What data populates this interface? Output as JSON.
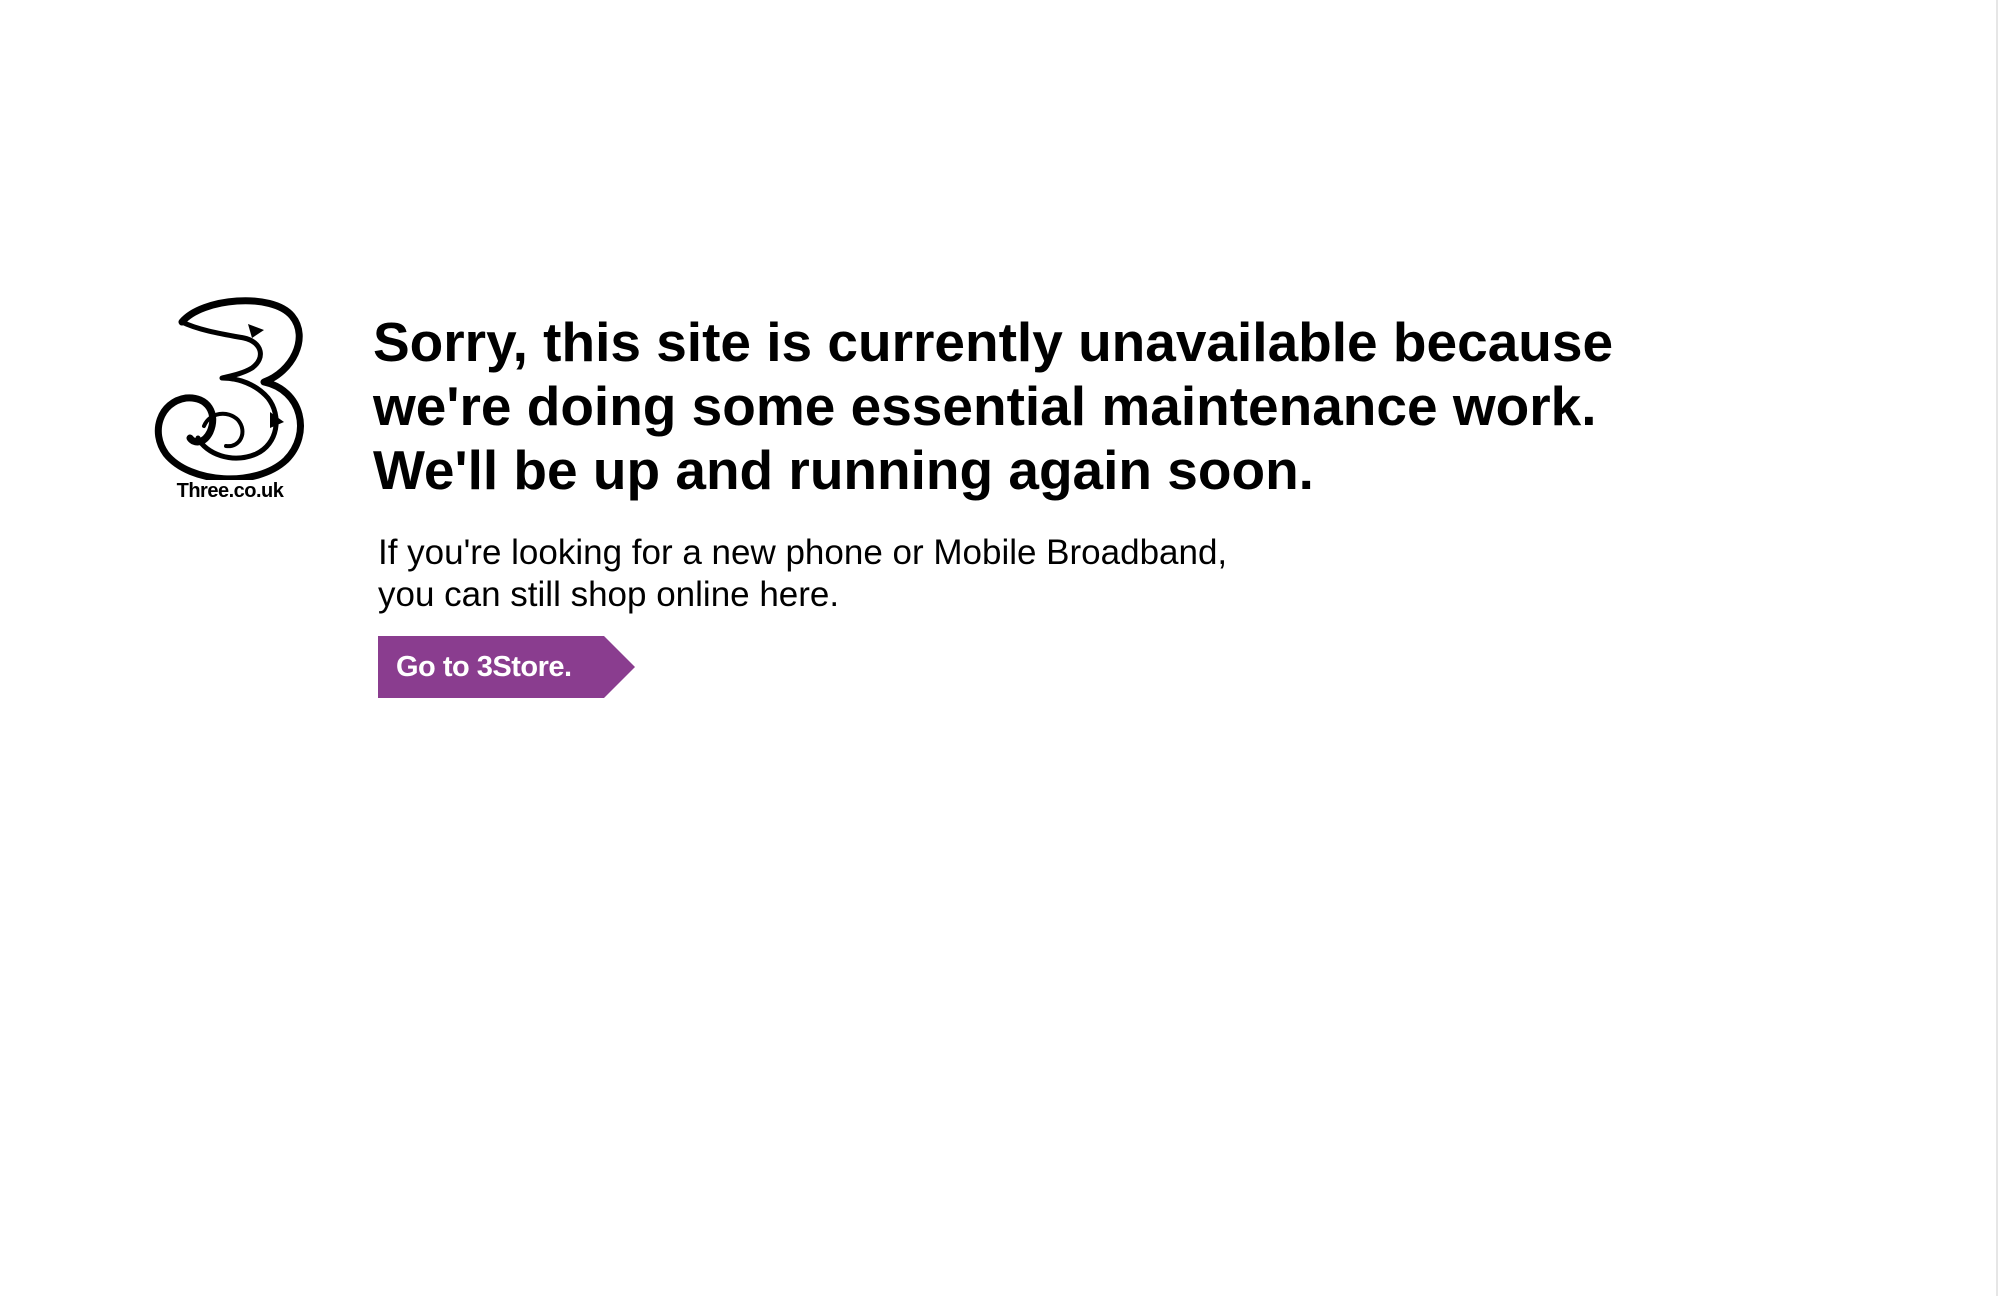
{
  "logo": {
    "icon": "three-logo-icon",
    "text": "Three.co.uk"
  },
  "message": {
    "headline_lines": [
      "Sorry, this site is currently unavailable because",
      "we're doing some essential maintenance work.",
      "We'll be up and running again soon."
    ],
    "subtext_lines": [
      "If you're looking for a new phone or Mobile Broadband,",
      "you can still shop online here."
    ]
  },
  "store_button": {
    "label": "Go to 3Store.",
    "icon": "arrow-tab-icon"
  },
  "colors": {
    "button_purple": "#8a3d8f",
    "text": "#000000",
    "background": "#ffffff"
  }
}
